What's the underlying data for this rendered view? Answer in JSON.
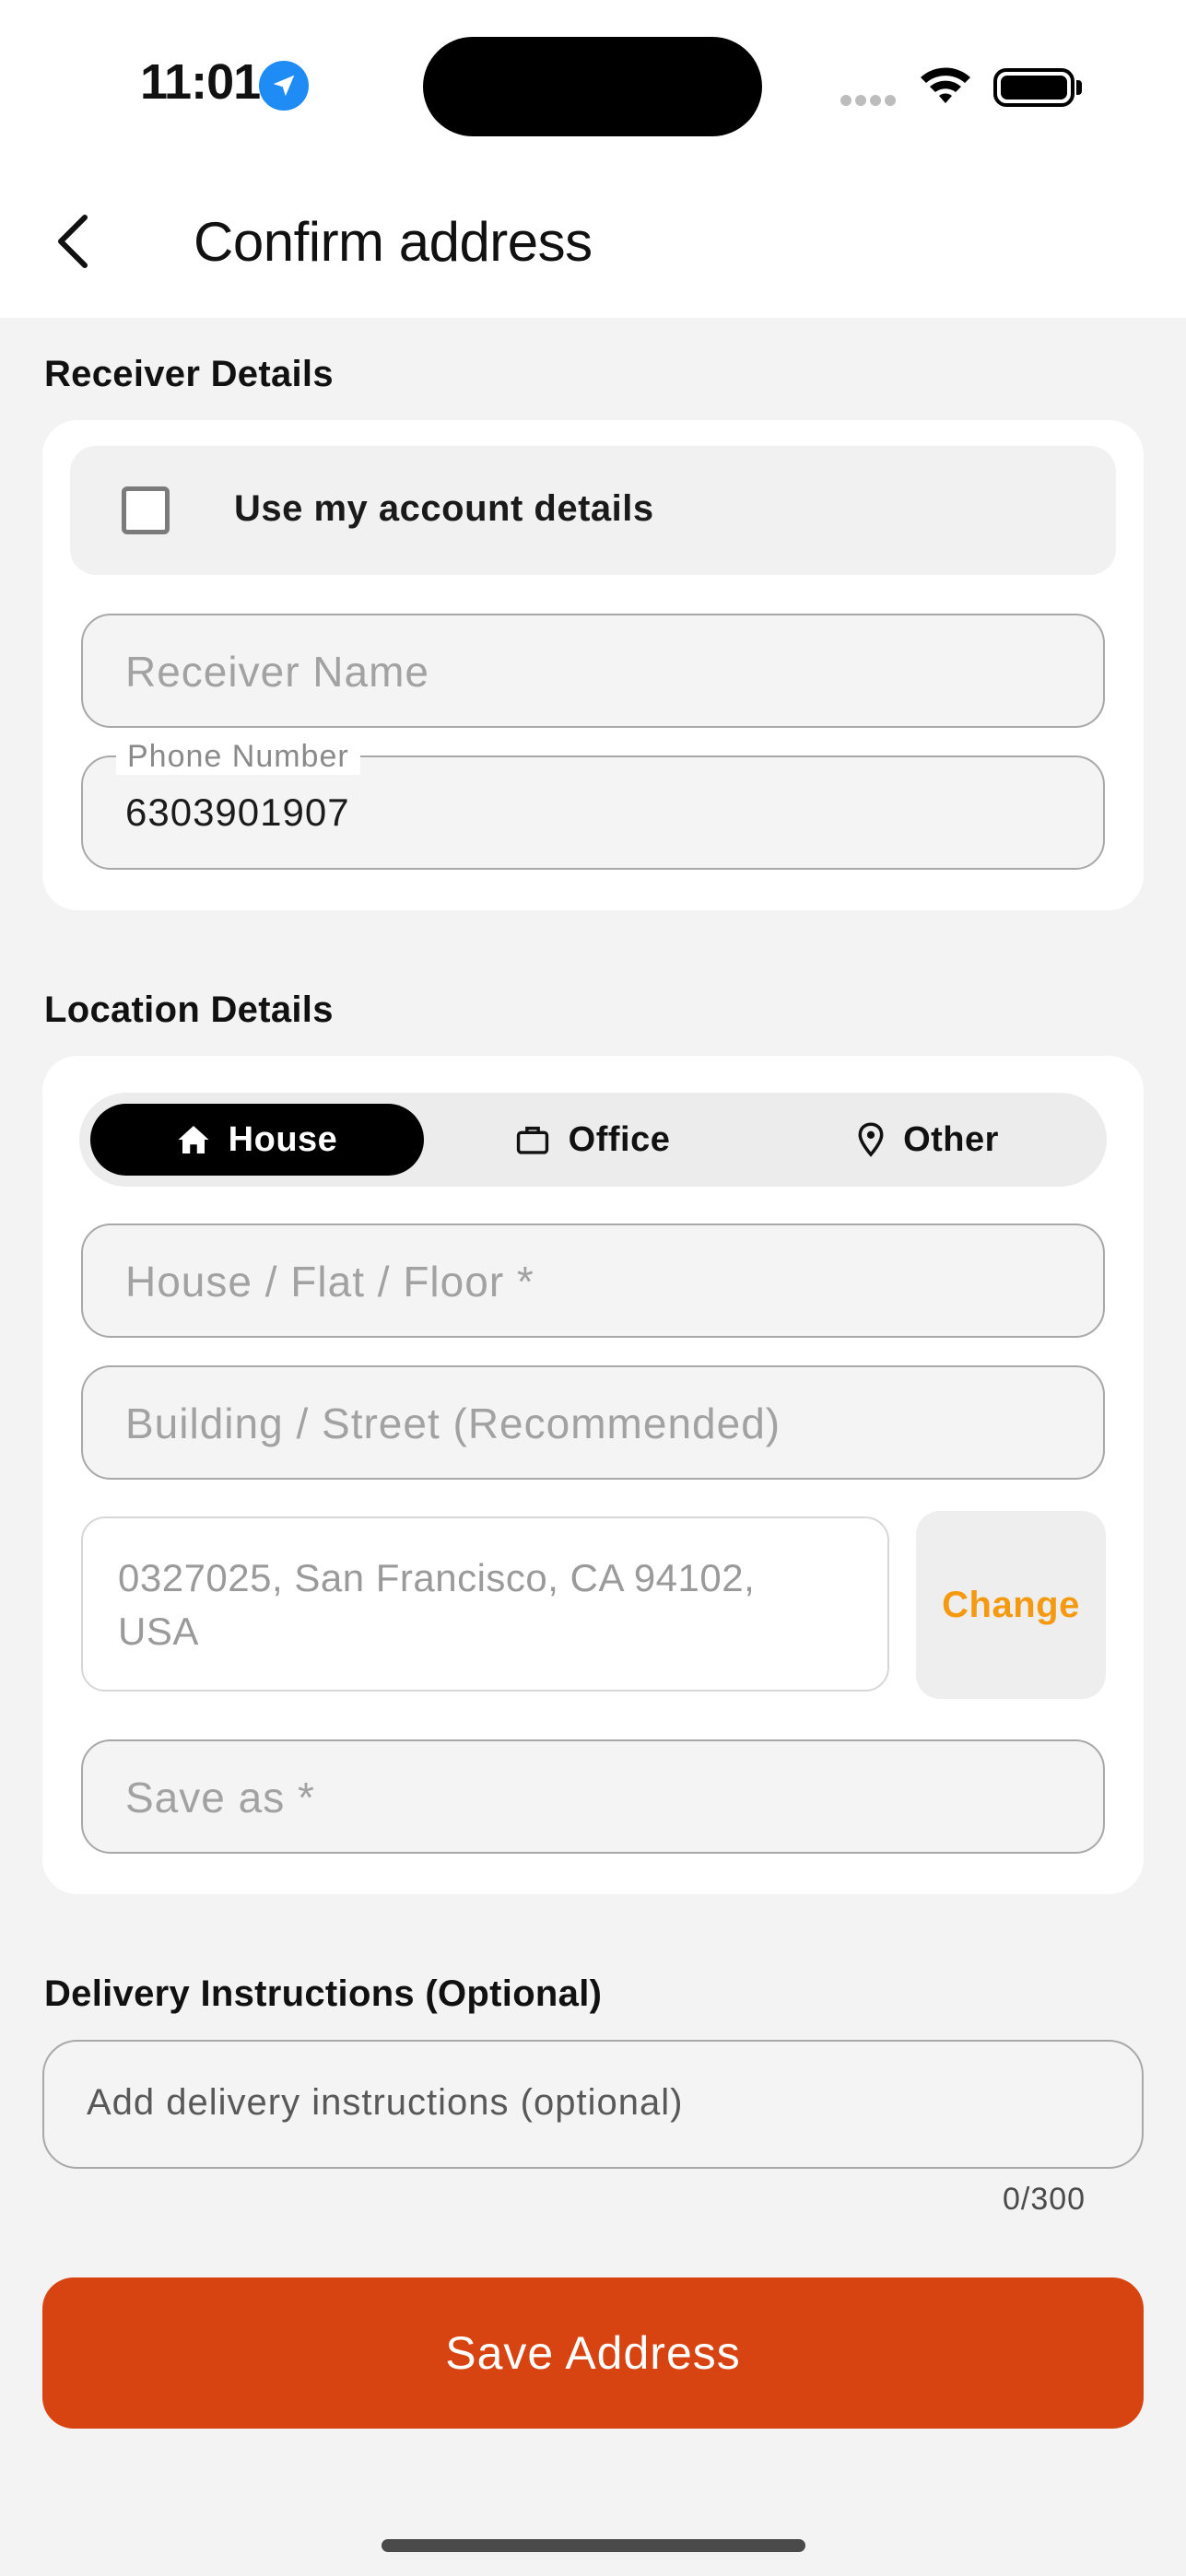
{
  "status_bar": {
    "time": "11:01"
  },
  "header": {
    "title": "Confirm address"
  },
  "receiver": {
    "section_label": "Receiver Details",
    "use_account_label": "Use my account details",
    "name_placeholder": "Receiver Name",
    "phone_label": "Phone Number",
    "phone_value": "6303901907"
  },
  "location": {
    "section_label": "Location Details",
    "tabs": [
      {
        "label": "House",
        "icon": "home-icon",
        "selected": true
      },
      {
        "label": "Office",
        "icon": "briefcase-icon",
        "selected": false
      },
      {
        "label": "Other",
        "icon": "map-pin-icon",
        "selected": false
      }
    ],
    "house_placeholder": "House / Flat / Floor *",
    "building_placeholder": "Building / Street (Recommended)",
    "address": "0327025, San Francisco, CA 94102, USA",
    "change_label": "Change",
    "save_as_placeholder": "Save as *"
  },
  "instructions": {
    "section_label": "Delivery Instructions (Optional)",
    "placeholder": "Add delivery instructions (optional)",
    "counter": "0/300"
  },
  "save_button_label": "Save Address",
  "colors": {
    "primary": "#d84312",
    "accent": "#f59a10",
    "location_badge": "#1f8cf5"
  }
}
